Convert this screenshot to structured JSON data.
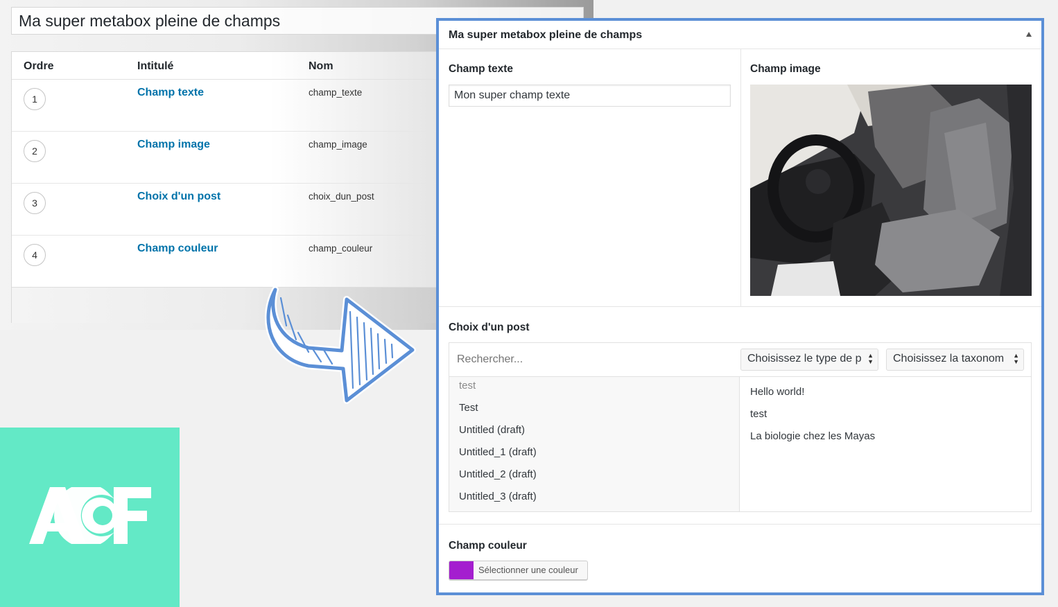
{
  "editor": {
    "title_value": "Ma super metabox pleine de champs",
    "columns": {
      "order": "Ordre",
      "label": "Intitulé",
      "name": "Nom"
    },
    "fields": [
      {
        "order": "1",
        "label": "Champ texte",
        "name": "champ_texte"
      },
      {
        "order": "2",
        "label": "Champ image",
        "name": "champ_image"
      },
      {
        "order": "3",
        "label": "Choix d'un post",
        "name": "choix_dun_post"
      },
      {
        "order": "4",
        "label": "Champ couleur",
        "name": "champ_couleur"
      }
    ]
  },
  "logo": {
    "text": "ACF",
    "background": "#63e9c6"
  },
  "metabox": {
    "title": "Ma super metabox pleine de champs",
    "accent": "#5b8fd6",
    "text_field": {
      "label": "Champ texte",
      "value": "Mon super champ texte"
    },
    "image_field": {
      "label": "Champ image",
      "alt": "car-interior-photo"
    },
    "relationship": {
      "label": "Choix d'un post",
      "search_placeholder": "Rechercher...",
      "post_type_select": "Choisissez le type de p",
      "taxonomy_select": "Choisissez la taxonom",
      "choices": [
        "test",
        "Test",
        "Untitled (draft)",
        "Untitled_1 (draft)",
        "Untitled_2 (draft)",
        "Untitled_3 (draft)"
      ],
      "selected": [
        "Hello world!",
        "test",
        "La biologie chez les Mayas"
      ]
    },
    "color_field": {
      "label": "Champ couleur",
      "button_label": "Sélectionner une couleur",
      "value": "#a41ecf"
    }
  }
}
